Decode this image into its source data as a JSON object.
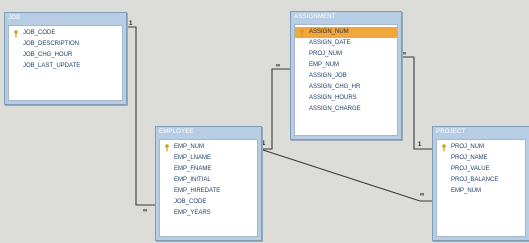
{
  "tables": {
    "job": {
      "title": "JOB",
      "fields": [
        "JOB_CODE",
        "JOB_DESCRIPTION",
        "JOB_CHG_HOUR",
        "JOB_LAST_UPDATE"
      ]
    },
    "assignment": {
      "title": "ASSIGNMENT",
      "fields": [
        "ASSIGN_NUM",
        "ASSIGN_DATE",
        "PROJ_NUM",
        "EMP_NUM",
        "ASSIGN_JOB",
        "ASSIGN_CHG_HR",
        "ASSIGN_HOURS",
        "ASSIGN_CHARGE"
      ]
    },
    "employee": {
      "title": "EMPLOYEE",
      "fields": [
        "EMP_NUM",
        "EMP_LNAME",
        "EMP_FNAME",
        "EMP_INITIAL",
        "EMP_HIREDATE",
        "JOB_CODE",
        "EMP_YEARS"
      ]
    },
    "project": {
      "title": "PROJECT",
      "fields": [
        "PROJ_NUM",
        "PROJ_NAME",
        "PROJ_VALUE",
        "PROJ_BALANCE",
        "EMP_NUM"
      ]
    }
  },
  "relationships": [
    {
      "from": "JOB.JOB_CODE",
      "to": "EMPLOYEE.JOB_CODE",
      "one": "1",
      "many": "∞"
    },
    {
      "from": "EMPLOYEE.EMP_NUM",
      "to": "ASSIGNMENT.EMP_NUM",
      "one": "1",
      "many": "∞"
    },
    {
      "from": "PROJECT.PROJ_NUM",
      "to": "ASSIGNMENT.PROJ_NUM",
      "one": "1",
      "many": "∞"
    },
    {
      "from": "EMPLOYEE.EMP_NUM",
      "to": "PROJECT.EMP_NUM",
      "one": "1",
      "many": "∞"
    }
  ],
  "colors": {
    "title_bar": "#b7cde4",
    "selected_field": "#f3a63c",
    "field_text": "#1d3d66",
    "background": "#dcdcd8"
  },
  "icons": {
    "primary_key": "key-icon"
  }
}
